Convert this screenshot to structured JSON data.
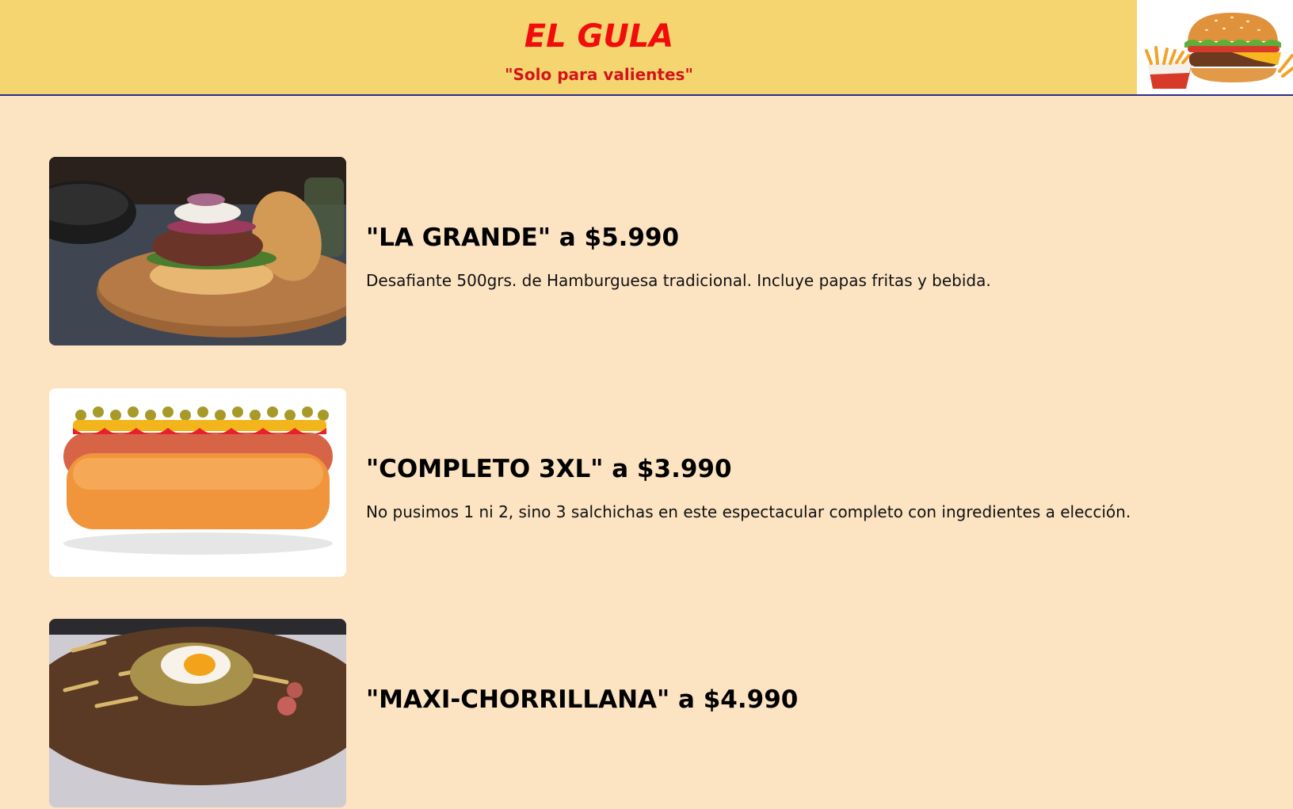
{
  "header": {
    "title": "EL GULA",
    "subtitle": "\"Solo para valientes\"",
    "logo_icon": "burger-and-fries-photo"
  },
  "menu": [
    {
      "title": "\"LA GRANDE\" a $5.990",
      "description": "Desafiante 500grs. de Hamburguesa tradicional. Incluye papas fritas y bebida.",
      "photo": "burger-photo"
    },
    {
      "title": "\"COMPLETO 3XL\" a $3.990",
      "description": "No pusimos 1 ni 2, sino 3 salchichas en este espectacular completo con ingredientes a elección.",
      "photo": "hotdog-photo"
    },
    {
      "title": "\"MAXI-CHORRILLANA\" a $4.990",
      "description": "",
      "photo": "chorrillana-photo"
    }
  ],
  "colors": {
    "page_background": "#fce3c2",
    "header_background": "#f5d570",
    "title_red": "#f20d0d",
    "subtitle_red": "#d4141b",
    "header_border": "#2c2c8c"
  }
}
